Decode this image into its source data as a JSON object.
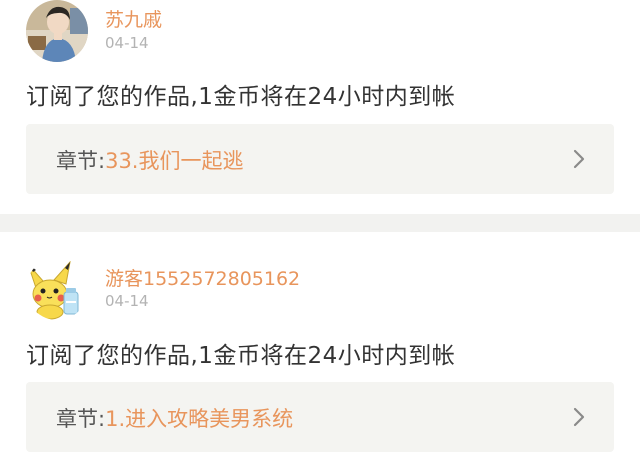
{
  "notifications": [
    {
      "username": "苏九戚",
      "date": "04-14",
      "message": "订阅了您的作品,1金币将在24小时内到帐",
      "chapter_label": "章节:",
      "chapter_title": "33.我们一起逃"
    },
    {
      "username": "游客1552572805162",
      "date": "04-14",
      "message": "订阅了您的作品,1金币将在24小时内到帐",
      "chapter_label": "章节:",
      "chapter_title": "1.进入攻略美男系统"
    }
  ],
  "colors": {
    "accent": "#e8955c",
    "text": "#333333",
    "muted": "#b3b3b3",
    "chapter_bg": "#f4f4f1",
    "separator": "#f2f2f0"
  },
  "icons": {
    "chevron": "chevron-right-icon",
    "avatar_1": "avatar-photo-person",
    "avatar_2": "avatar-pikachu"
  }
}
